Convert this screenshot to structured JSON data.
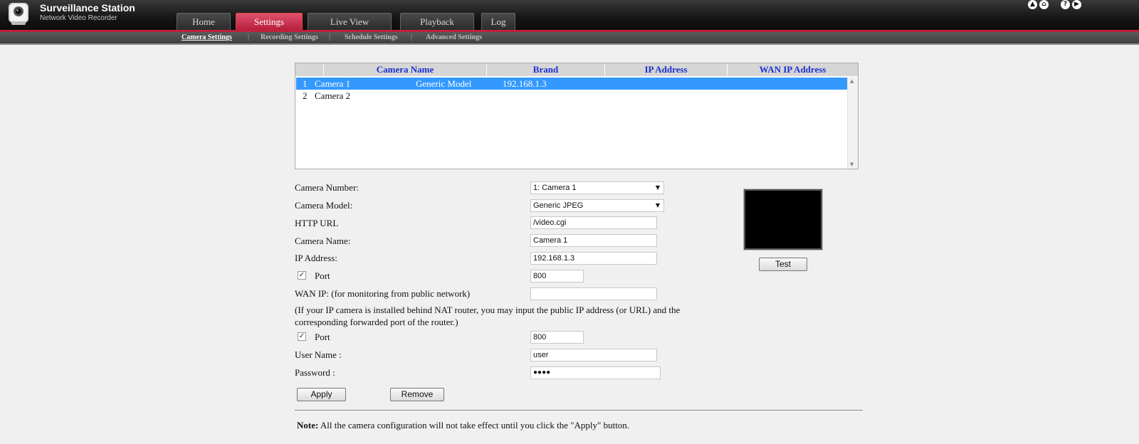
{
  "app": {
    "title": "Surveillance Station",
    "subtitle": "Network Video Recorder"
  },
  "tabs": [
    {
      "label": "Home",
      "active": false
    },
    {
      "label": "Settings",
      "active": true
    },
    {
      "label": "Live View",
      "active": false
    },
    {
      "label": "Playback",
      "active": false
    },
    {
      "label": "Log",
      "active": false
    }
  ],
  "top_icons": [
    "up-circle-icon",
    "home-icon",
    "help-icon",
    "play-circle-icon"
  ],
  "subnav": [
    {
      "label": "Camera Settings",
      "active": true
    },
    {
      "label": "Recording Settings",
      "active": false
    },
    {
      "label": "Schedule Settings",
      "active": false
    },
    {
      "label": "Advanced Settings",
      "active": false
    }
  ],
  "camera_table": {
    "columns": [
      "",
      "Camera Name",
      "Brand",
      "IP Address",
      "WAN IP Address"
    ],
    "rows": [
      {
        "num": "1",
        "name": "Camera 1",
        "brand": "Generic Model",
        "ip": "192.168.1.3",
        "wan_ip": "",
        "selected": true
      },
      {
        "num": "2",
        "name": "Camera 2",
        "brand": "",
        "ip": "",
        "wan_ip": "",
        "selected": false
      }
    ]
  },
  "form": {
    "camera_number_label": "Camera Number:",
    "camera_number_value": "1: Camera 1",
    "camera_model_label": "Camera Model:",
    "camera_model_value": "Generic JPEG",
    "http_url_label": "HTTP URL",
    "http_url_value": "/video.cgi",
    "camera_name_label": "Camera Name:",
    "camera_name_value": "Camera 1",
    "ip_address_label": "IP Address:",
    "ip_address_value": "192.168.1.3",
    "port_label": "Port",
    "port_value": "800",
    "port_checked": true,
    "wan_ip_label": "WAN IP: (for monitoring from public network)",
    "wan_ip_value": "",
    "nat_note_line1": "(If your IP camera is installed behind NAT router, you may input the public IP address (or URL) and the",
    "nat_note_line2": "corresponding forwarded port of the router.)",
    "wan_port_label": "Port",
    "wan_port_value": "800",
    "wan_port_checked": true,
    "username_label": "User Name :",
    "username_value": "user",
    "password_label": "Password :",
    "password_value": "●●●●",
    "apply_label": "Apply",
    "remove_label": "Remove",
    "test_label": "Test"
  },
  "note": {
    "prefix": "Note:",
    "text": " All the camera configuration will not take effect until you click the \"Apply\" button."
  },
  "colors": {
    "accent": "#c0203c",
    "header_link": "#1a2fd0",
    "selected_row": "#3399ff"
  }
}
